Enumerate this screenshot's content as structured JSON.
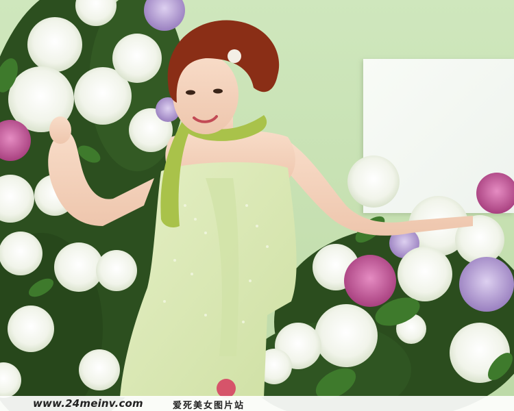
{
  "image": {
    "subject": "woman in a light green dress among hydrangea flowers"
  },
  "watermark": {
    "url": "www.24meinv.com",
    "site_name": "爱死美女图片站"
  },
  "colors": {
    "wall": "#c9e2b5",
    "dress": "#dbe9b5",
    "boa": "#a9c24a",
    "hair": "#8a2e16",
    "leaf": "#2f5d22",
    "white_flower": "#f4f6ee",
    "pink_flower": "#c9609e",
    "lilac_flower": "#b9a2d6"
  }
}
